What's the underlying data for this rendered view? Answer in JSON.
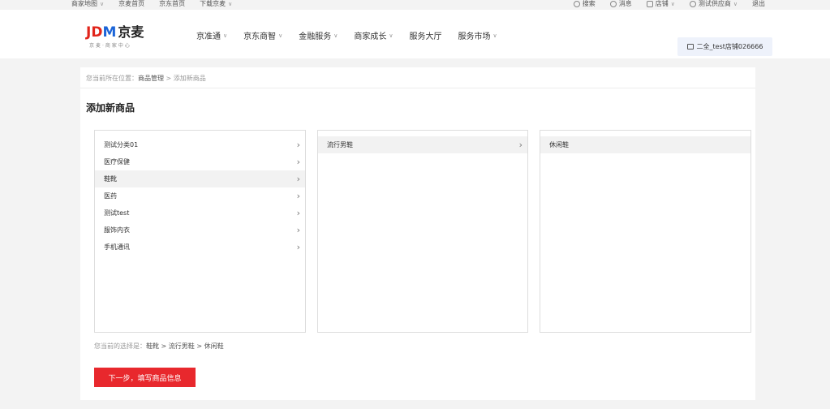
{
  "topbar": {
    "left": [
      {
        "label": "商家地图",
        "caret": true
      },
      {
        "label": "京麦首页",
        "caret": false
      },
      {
        "label": "京东首页",
        "caret": false
      },
      {
        "label": "下载京麦",
        "caret": true
      }
    ],
    "right": [
      {
        "label": "搜索",
        "icon": "search-icon",
        "caret": false
      },
      {
        "label": "消息",
        "icon": "message-icon",
        "caret": false
      },
      {
        "label": "店铺",
        "icon": "shop-icon",
        "caret": true
      },
      {
        "label": "测试供应商",
        "icon": "user-icon",
        "caret": true
      },
      {
        "label": "退出",
        "icon": "",
        "caret": false
      }
    ]
  },
  "header": {
    "logo": {
      "jd": "JD",
      "m": "M",
      "cn": "京麦",
      "sub": "京麦·商家中心"
    },
    "nav": [
      {
        "label": "京准通",
        "caret": true
      },
      {
        "label": "京东商智",
        "caret": true
      },
      {
        "label": "金融服务",
        "caret": true
      },
      {
        "label": "商家成长",
        "caret": true
      },
      {
        "label": "服务大厅",
        "caret": false
      },
      {
        "label": "服务市场",
        "caret": true
      }
    ],
    "store": "二全_test店铺026666"
  },
  "breadcrumb": {
    "prefix": "您当前所在位置：",
    "path1": "商品管理",
    "sep": " > ",
    "path2": "添加新商品"
  },
  "page_title": "添加新商品",
  "columns": {
    "col1": [
      {
        "label": "测试分类01",
        "arrow": true,
        "active": false
      },
      {
        "label": "医疗保健",
        "arrow": true,
        "active": false
      },
      {
        "label": "鞋靴",
        "arrow": true,
        "active": true
      },
      {
        "label": "医药",
        "arrow": true,
        "active": false
      },
      {
        "label": "测试test",
        "arrow": true,
        "active": false
      },
      {
        "label": "服饰内衣",
        "arrow": true,
        "active": false
      },
      {
        "label": "手机通讯",
        "arrow": true,
        "active": false
      }
    ],
    "col2": [
      {
        "label": "流行男鞋",
        "arrow": true,
        "active": true
      }
    ],
    "col3": [
      {
        "label": "休闲鞋",
        "arrow": false,
        "active": true
      }
    ]
  },
  "selection": {
    "prefix": "您当前的选择是：",
    "value": "鞋靴 > 流行男鞋 > 休闲鞋"
  },
  "next_button": "下一步，填写商品信息",
  "icons": {
    "chevron": "›",
    "caret": "∨"
  }
}
